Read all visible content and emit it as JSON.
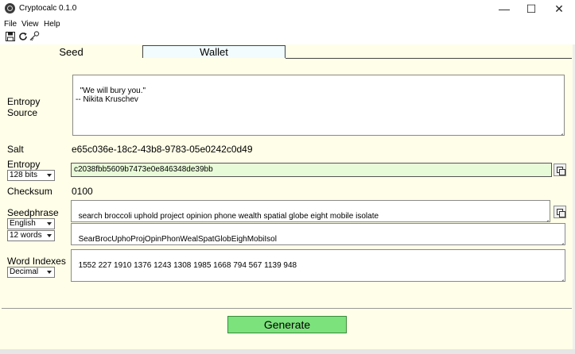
{
  "window": {
    "title": "Cryptocalc 0.1.0",
    "controls": {
      "minimize": "—",
      "maximize": "☐",
      "close": "✕"
    }
  },
  "menu": [
    "File",
    "View",
    "Help"
  ],
  "toolbar": {
    "icons": [
      "save-icon",
      "refresh-icon",
      "keys-icon"
    ]
  },
  "tabs": {
    "seed": "Seed",
    "wallet": "Wallet"
  },
  "form": {
    "entropy_source_label_line1": "Entropy",
    "entropy_source_label_line2": "Source",
    "entropy_source_value": "\"We will bury you.\"\n-- Nikita Kruschev",
    "salt_label": "Salt",
    "salt_value": "e65c036e-18c2-43b8-9783-05e0242c0d49",
    "entropy_label": "Entropy",
    "entropy_bits": "128 bits",
    "entropy_value": "c2038fbb5609b7473e0e846348de39bb",
    "checksum_label": "Checksum",
    "checksum_value": "0100",
    "seedphrase_label": "Seedphrase",
    "seedphrase_language": "English",
    "seedphrase_words": "12 words",
    "seedphrase_value": "search broccoli uphold project opinion phone wealth spatial globe eight mobile isolate",
    "seedphrase_short": "SearBrocUphoProjOpinPhonWealSpatGlobEighMobiIsol",
    "word_indexes_label": "Word Indexes",
    "word_indexes_format": "Decimal",
    "word_indexes_value": "1552 227 1910 1376 1243 1308 1985 1668 794 567 1139 948"
  },
  "generate_label": "Generate",
  "colors": {
    "background": "#fffee8",
    "entropy_field": "#e8fbd8",
    "generate_button": "#7ce27c",
    "wallet_tab": "#f2fbfd"
  }
}
